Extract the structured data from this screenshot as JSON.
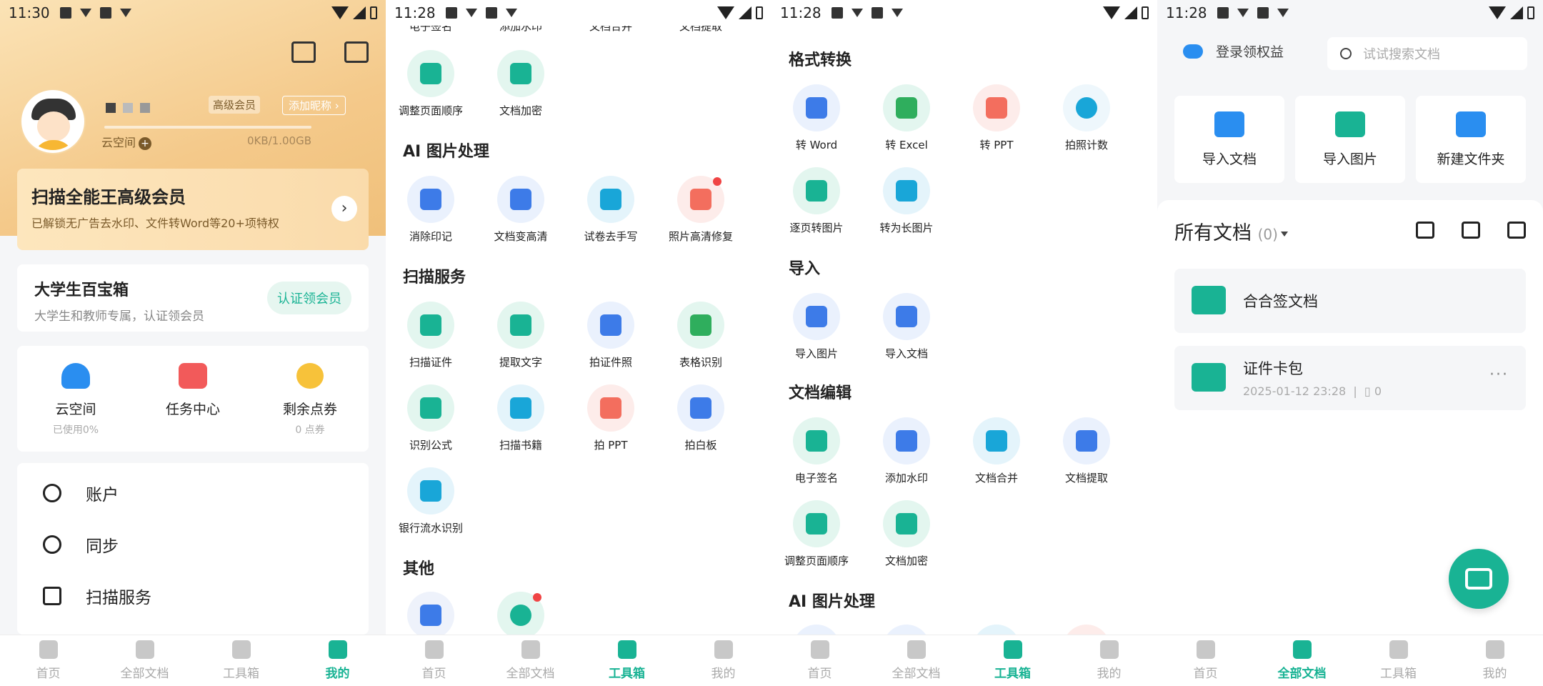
{
  "colors": {
    "accent": "#19b394",
    "vip_gold": "#f4c98a",
    "blue": "#2a8ef0",
    "red_dot": "#f04444"
  },
  "tabs": [
    "首页",
    "全部文档",
    "工具箱",
    "我的"
  ],
  "screen1": {
    "time": "11:30",
    "level": "高级会员",
    "add_nickname": "添加昵称",
    "add_nickname_arrow": "›",
    "cloud": "云空间",
    "cloud_plus": "+",
    "storage": "0KB/1.00GB",
    "vip_title": "扫描全能王高级会员",
    "vip_sub": "已解锁无广告去水印、文件转Word等20+项特权",
    "vip_arrow": "›",
    "baibao_title": "大学生百宝箱",
    "baibao_sub": "大学生和教师专属，认证领会员",
    "baibao_btn": "认证领会员",
    "stats": [
      {
        "label": "云空间",
        "sub": "已使用0%",
        "icon": "cloud-upload-icon"
      },
      {
        "label": "任务中心",
        "sub": "",
        "icon": "task-check-icon"
      },
      {
        "label": "剩余点券",
        "sub": "0 点券",
        "icon": "coupon-icon"
      }
    ],
    "menu": [
      {
        "label": "账户",
        "icon": "account-icon"
      },
      {
        "label": "同步",
        "icon": "sync-icon"
      },
      {
        "label": "扫描服务",
        "icon": "scan-service-icon"
      }
    ]
  },
  "screen2": {
    "time": "11:28",
    "top_partial": [
      "电子签名",
      "添加水印",
      "文档合并",
      "文档提取"
    ],
    "top_items": [
      "调整页面顺序",
      "文档加密"
    ],
    "sections": [
      {
        "title": "AI 图片处理",
        "items": [
          "消除印记",
          "文档变高清",
          "试卷去手写",
          "照片高清修复"
        ]
      },
      {
        "title": "扫描服务",
        "items": [
          "扫描证件",
          "提取文字",
          "拍证件照",
          "表格识别",
          "识别公式",
          "扫描书籍",
          "拍 PPT",
          "拍白板",
          "银行流水识别"
        ]
      },
      {
        "title": "其他",
        "items": [
          "",
          ""
        ]
      }
    ]
  },
  "screen3": {
    "time": "11:28",
    "sections": [
      {
        "title": "格式转换",
        "items": [
          "转 Word",
          "转 Excel",
          "转 PPT",
          "拍照计数",
          "逐页转图片",
          "转为长图片"
        ]
      },
      {
        "title": "导入",
        "items": [
          "导入图片",
          "导入文档"
        ]
      },
      {
        "title": "文档编辑",
        "items": [
          "电子签名",
          "添加水印",
          "文档合并",
          "文档提取",
          "调整页面顺序",
          "文档加密"
        ]
      },
      {
        "title": "AI 图片处理",
        "items": []
      }
    ]
  },
  "screen4": {
    "time": "11:28",
    "login": "登录领权益",
    "search_placeholder": "试试搜索文档",
    "quick": [
      "导入文档",
      "导入图片",
      "新建文件夹"
    ],
    "all_docs": "所有文档",
    "count": "(0)",
    "folders": [
      {
        "name": "合合签文档"
      },
      {
        "name": "证件卡包",
        "date": "2025-01-12 23:28",
        "count": "0"
      }
    ],
    "more": "···"
  }
}
